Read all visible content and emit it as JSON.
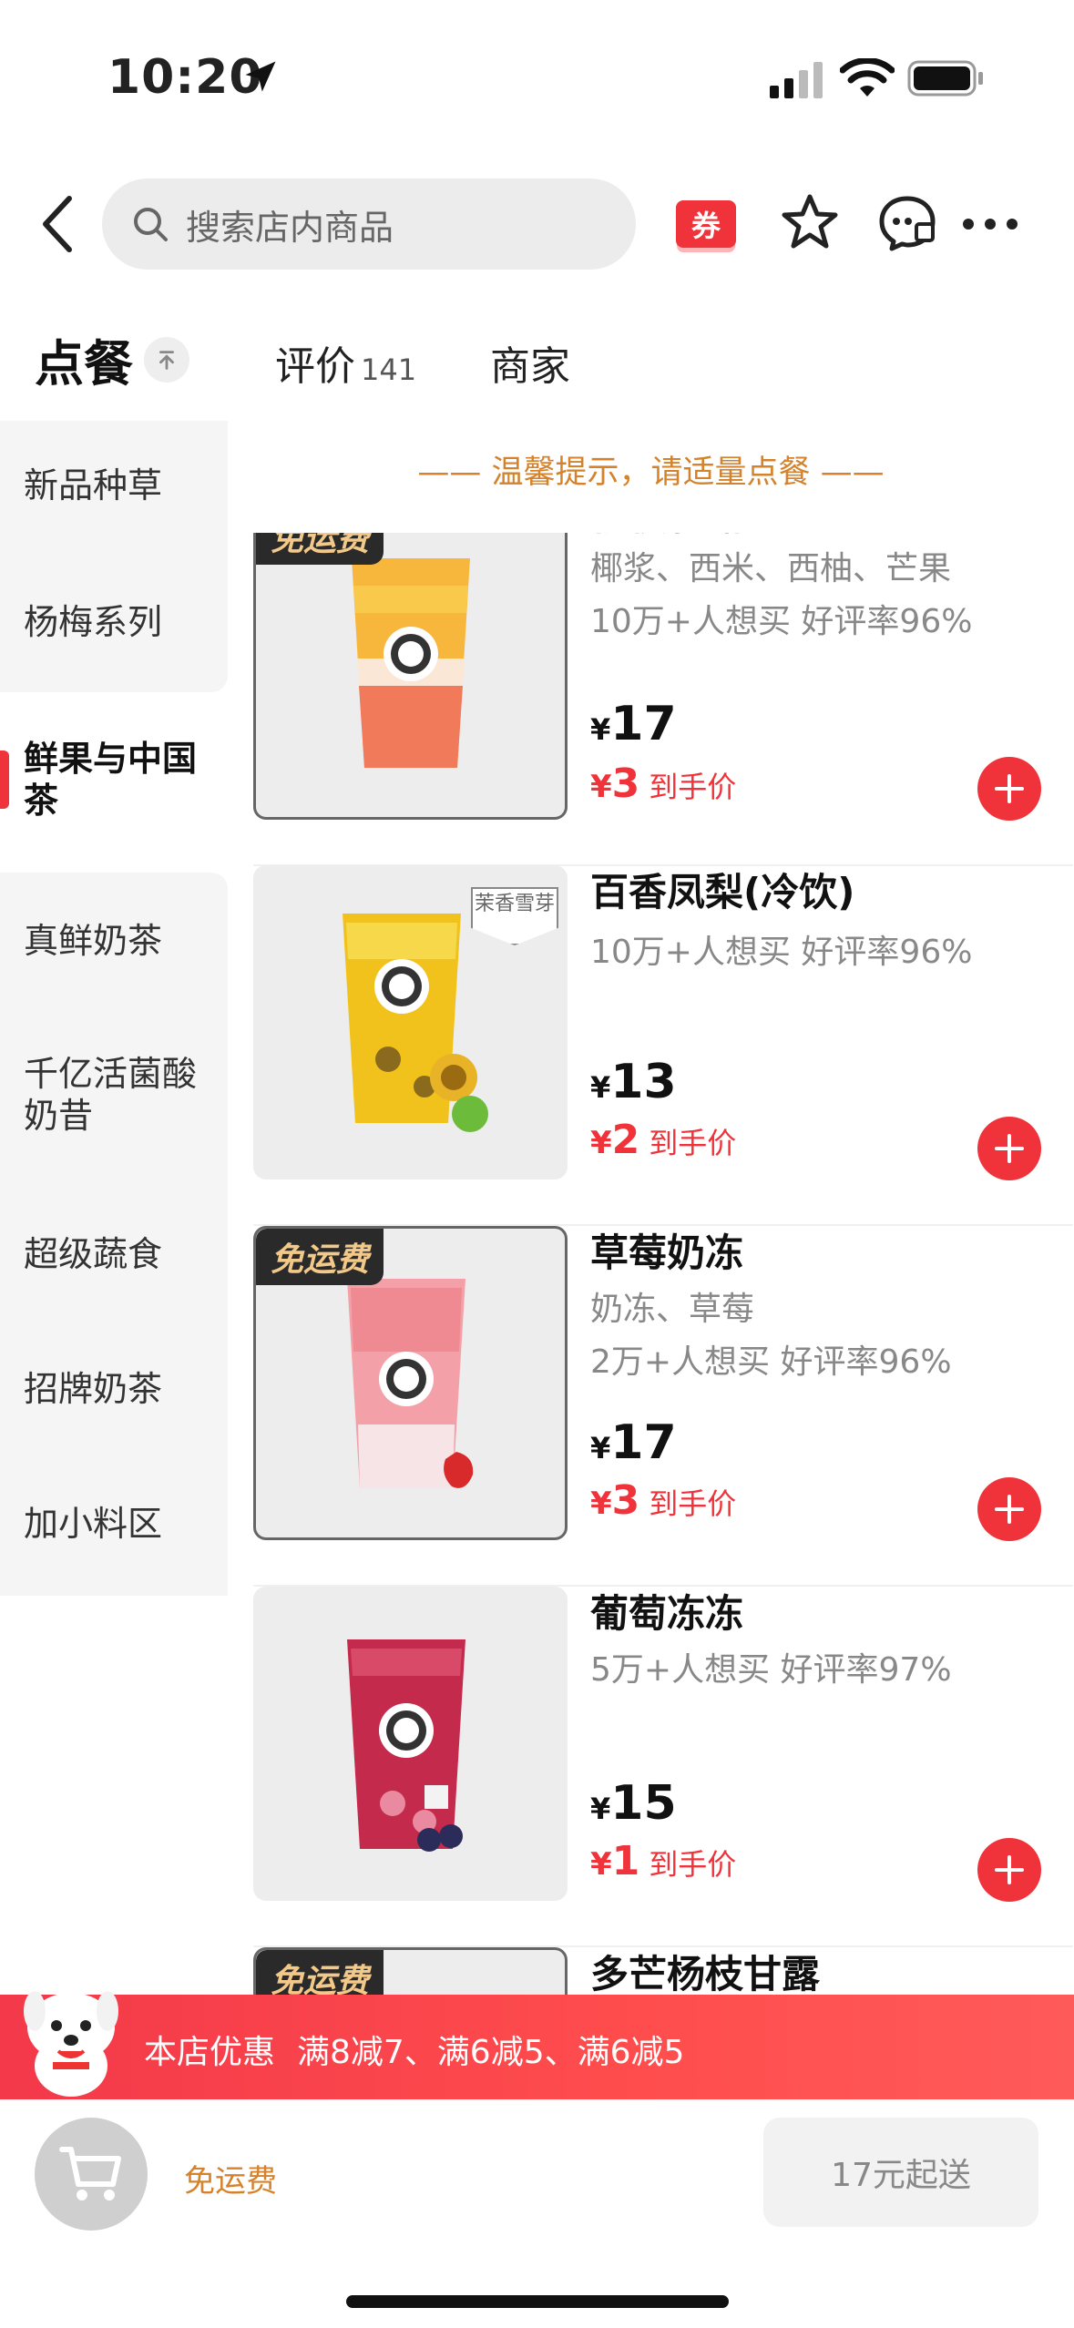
{
  "status_bar": {
    "time": "10:20"
  },
  "header": {
    "search_placeholder": "搜索店内商品",
    "coupon_label": "券"
  },
  "tabs": {
    "order": "点餐",
    "review": "评价",
    "review_count": "141",
    "merchant": "商家"
  },
  "sidebar": {
    "items": [
      {
        "label": "新品种草"
      },
      {
        "label": "杨梅系列"
      },
      {
        "label": "鲜果与中国茶",
        "active": true
      },
      {
        "label": "真鲜奶茶"
      },
      {
        "label": "千亿活菌酸奶昔"
      },
      {
        "label": "超级蔬食"
      },
      {
        "label": "招牌奶茶"
      },
      {
        "label": "加小料区"
      }
    ]
  },
  "tip": "—— 温馨提示，请适量点餐 ——",
  "products": [
    {
      "name": "杨枝甘露",
      "ingredients": "椰浆、西米、西柚、芒果",
      "stats": "10万+人想买 好评率96%",
      "price": "17",
      "final_price": "3",
      "final_label": "到手价",
      "badge": "免运费"
    },
    {
      "name": "百香凤梨(冷饮)",
      "ingredients": "",
      "stats": "10万+人想买 好评率96%",
      "price": "13",
      "final_price": "2",
      "final_label": "到手价",
      "tea_badge": "茉香雪芽"
    },
    {
      "name": "草莓奶冻",
      "ingredients": "奶冻、草莓",
      "stats": "2万+人想买 好评率96%",
      "price": "17",
      "final_price": "3",
      "final_label": "到手价",
      "badge": "免运费"
    },
    {
      "name": "葡萄冻冻",
      "ingredients": "",
      "stats": "5万+人想买 好评率97%",
      "price": "15",
      "final_price": "1",
      "final_label": "到手价"
    },
    {
      "name": "多芒杨枝甘露",
      "badge": "免运费"
    }
  ],
  "currency": "¥",
  "promo": {
    "title": "本店优惠",
    "detail": "满8减7、满6减5、满6减5"
  },
  "bottom": {
    "free_shipping": "免运费",
    "min_order": "17元起送"
  },
  "colors": {
    "accent": "#f0333a",
    "tip": "#d4832c"
  }
}
